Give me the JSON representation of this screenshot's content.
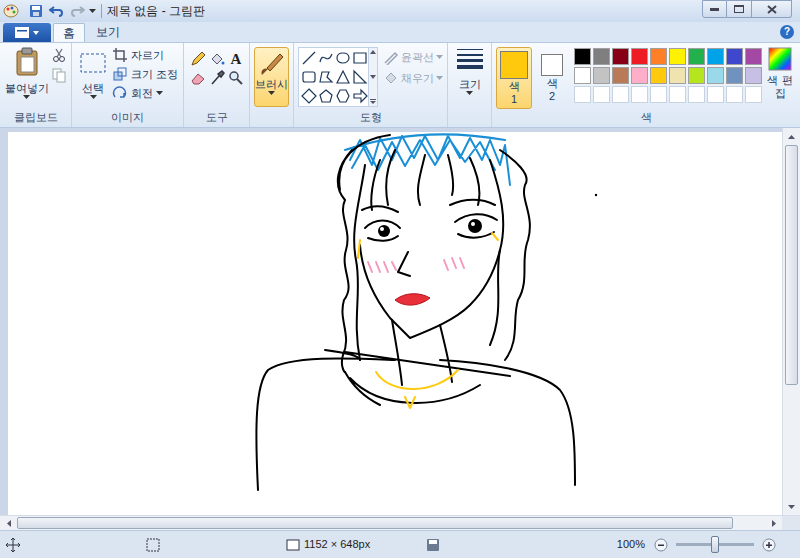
{
  "window": {
    "title": "제목 없음 - 그림판"
  },
  "tabs": [
    {
      "label": "홈",
      "selected": true
    },
    {
      "label": "보기",
      "selected": false
    }
  ],
  "help": "?",
  "ribbon": {
    "clipboard": {
      "label": "클립보드",
      "paste": "붙여넣기"
    },
    "image": {
      "label": "이미지",
      "select": "선택",
      "commands": [
        "자르기",
        "크기 조정",
        "회전"
      ]
    },
    "tools": {
      "label": "도구",
      "text_tool": "A"
    },
    "brush": {
      "label": "브러시",
      "selected": true
    },
    "shapes": {
      "label": "도형",
      "outline": {
        "label": "윤곽선",
        "disabled": true
      },
      "fill": {
        "label": "채우기",
        "disabled": true
      }
    },
    "size": {
      "label": "크기"
    },
    "colors": {
      "label": "색",
      "slots": [
        {
          "label": "색 1",
          "color": "#ffc90e",
          "selected": true
        },
        {
          "label": "색 2",
          "color": "#ffffff",
          "selected": false
        }
      ],
      "palette": [
        [
          {
            "color": "#000000",
            "empty": false
          },
          {
            "color": "#7f7f7f",
            "empty": false
          },
          {
            "color": "#880015",
            "empty": false
          },
          {
            "color": "#ed1c24",
            "empty": false
          },
          {
            "color": "#ff7f27",
            "empty": false
          },
          {
            "color": "#fff200",
            "empty": false
          },
          {
            "color": "#22b14c",
            "empty": false
          },
          {
            "color": "#00a2e8",
            "empty": false
          },
          {
            "color": "#3f48cc",
            "empty": false
          },
          {
            "color": "#a349a4",
            "empty": false
          }
        ],
        [
          {
            "color": "#ffffff",
            "empty": false
          },
          {
            "color": "#c3c3c3",
            "empty": false
          },
          {
            "color": "#b97a57",
            "empty": false
          },
          {
            "color": "#ffaec9",
            "empty": false
          },
          {
            "color": "#ffc90e",
            "empty": false
          },
          {
            "color": "#efe4b0",
            "empty": false
          },
          {
            "color": "#b5e61d",
            "empty": false
          },
          {
            "color": "#99d9ea",
            "empty": false
          },
          {
            "color": "#7092be",
            "empty": false
          },
          {
            "color": "#c8bfe7",
            "empty": false
          }
        ],
        [
          {
            "color": "#ffffff",
            "empty": true
          },
          {
            "color": "#ffffff",
            "empty": true
          },
          {
            "color": "#ffffff",
            "empty": true
          },
          {
            "color": "#ffffff",
            "empty": true
          },
          {
            "color": "#ffffff",
            "empty": true
          },
          {
            "color": "#ffffff",
            "empty": true
          },
          {
            "color": "#ffffff",
            "empty": true
          },
          {
            "color": "#ffffff",
            "empty": true
          },
          {
            "color": "#ffffff",
            "empty": true
          },
          {
            "color": "#ffffff",
            "empty": true
          }
        ]
      ],
      "edit": "색 편집"
    }
  },
  "status_bar": {
    "dimensions": "1152 × 648px",
    "zoom": "100%",
    "zoom_level": 0.5
  }
}
